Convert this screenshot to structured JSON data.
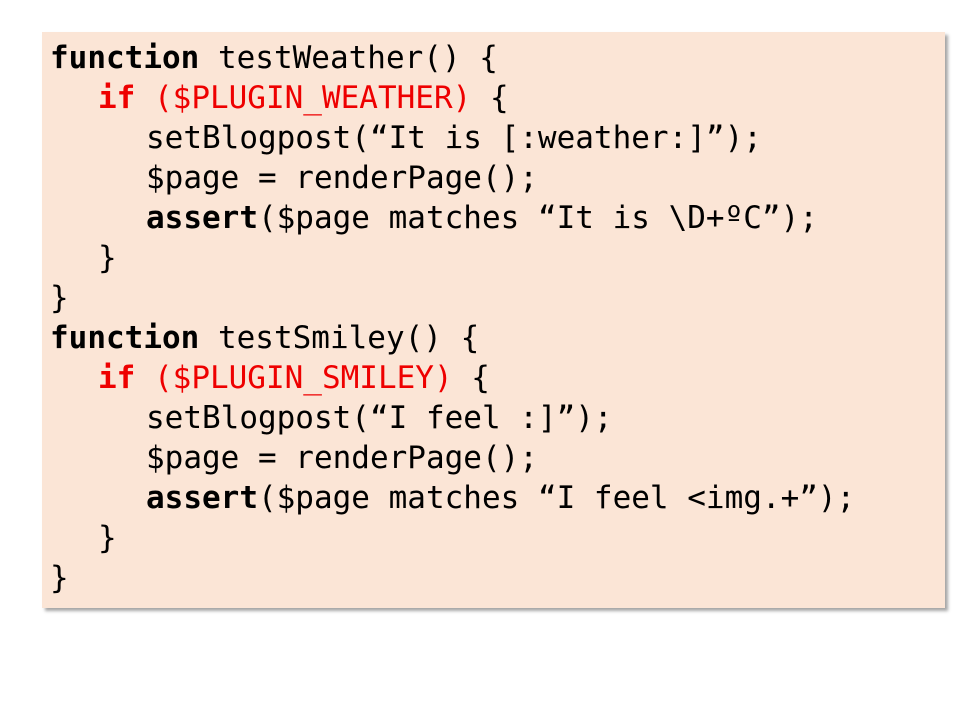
{
  "colors": {
    "background": "#ffffff",
    "code_box": "#fbe5d6",
    "text": "#000000",
    "conditional": "#ee0000"
  },
  "code": {
    "fn1": {
      "keyword": "function",
      "signature": " testWeather() {",
      "if_keyword": "if",
      "if_condition": " ($PLUGIN_WEATHER)",
      "if_brace": " {",
      "stmt1": "setBlogpost(“It is [:weather:]”);",
      "stmt2": "$page = renderPage();",
      "assert_keyword": "assert",
      "assert_args": "($page matches “It is \\D+ºC”);",
      "close_inner": "}",
      "close_outer": "}"
    },
    "fn2": {
      "keyword": "function",
      "signature": " testSmiley() {",
      "if_keyword": "if",
      "if_condition": " ($PLUGIN_SMILEY)",
      "if_brace": " {",
      "stmt1": "setBlogpost(“I feel :]”);",
      "stmt2": "$page = renderPage();",
      "assert_keyword": "assert",
      "assert_args": "($page matches “I feel <img.+”);",
      "close_inner": "}",
      "close_outer": "}"
    }
  }
}
